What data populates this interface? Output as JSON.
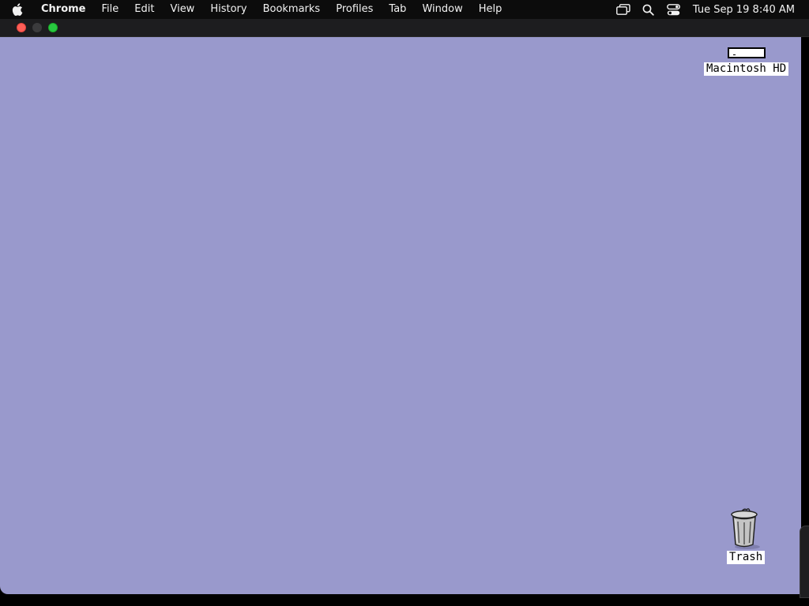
{
  "menubar": {
    "app_name": "Chrome",
    "items": [
      {
        "label": "File"
      },
      {
        "label": "Edit"
      },
      {
        "label": "View"
      },
      {
        "label": "History"
      },
      {
        "label": "Bookmarks"
      },
      {
        "label": "Profiles"
      },
      {
        "label": "Tab"
      },
      {
        "label": "Window"
      },
      {
        "label": "Help"
      }
    ],
    "status_icons": [
      "screen-mirroring-icon",
      "search-icon",
      "control-center-icon"
    ],
    "clock": "Tue Sep 19  8:40 AM"
  },
  "window": {
    "traffic_lights": {
      "close": "#ff5f57",
      "minimize": "#3b3b3d",
      "maximize": "#28c840"
    }
  },
  "desktop": {
    "background_color": "#9999cc",
    "icons": [
      {
        "label": "Macintosh HD",
        "icon": "hard-drive-icon"
      },
      {
        "label": "Trash",
        "icon": "trash-icon"
      }
    ]
  }
}
